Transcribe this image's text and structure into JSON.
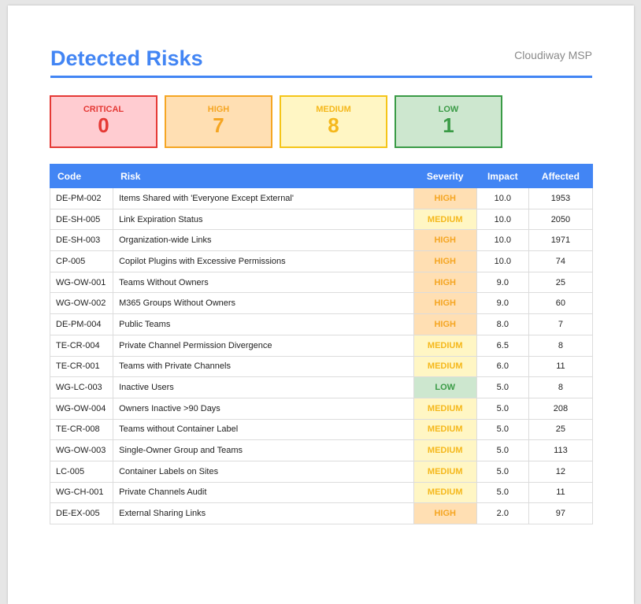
{
  "header": {
    "title": "Detected Risks",
    "brand": "Cloudiway MSP"
  },
  "summary": [
    {
      "label": "CRITICAL",
      "count": "0",
      "color": "#e53935"
    },
    {
      "label": "HIGH",
      "count": "7",
      "color": "#f5a623"
    },
    {
      "label": "MEDIUM",
      "count": "8",
      "color": "#f5b81c"
    },
    {
      "label": "LOW",
      "count": "1",
      "color": "#3a9b46"
    }
  ],
  "table": {
    "columns": [
      "Code",
      "Risk",
      "Severity",
      "Impact",
      "Affected"
    ],
    "rows": [
      {
        "code": "DE-PM-002",
        "risk": "Items Shared with 'Everyone Except External'",
        "severity": "HIGH",
        "impact": "10.0",
        "affected": "1953"
      },
      {
        "code": "DE-SH-005",
        "risk": "Link Expiration Status",
        "severity": "MEDIUM",
        "impact": "10.0",
        "affected": "2050"
      },
      {
        "code": "DE-SH-003",
        "risk": "Organization-wide Links",
        "severity": "HIGH",
        "impact": "10.0",
        "affected": "1971"
      },
      {
        "code": "CP-005",
        "risk": "Copilot Plugins with Excessive Permissions",
        "severity": "HIGH",
        "impact": "10.0",
        "affected": "74"
      },
      {
        "code": "WG-OW-001",
        "risk": "Teams Without Owners",
        "severity": "HIGH",
        "impact": "9.0",
        "affected": "25"
      },
      {
        "code": "WG-OW-002",
        "risk": "M365 Groups Without Owners",
        "severity": "HIGH",
        "impact": "9.0",
        "affected": "60"
      },
      {
        "code": "DE-PM-004",
        "risk": "Public Teams",
        "severity": "HIGH",
        "impact": "8.0",
        "affected": "7"
      },
      {
        "code": "TE-CR-004",
        "risk": "Private Channel Permission Divergence",
        "severity": "MEDIUM",
        "impact": "6.5",
        "affected": "8"
      },
      {
        "code": "TE-CR-001",
        "risk": "Teams with Private Channels",
        "severity": "MEDIUM",
        "impact": "6.0",
        "affected": "11"
      },
      {
        "code": "WG-LC-003",
        "risk": "Inactive Users",
        "severity": "LOW",
        "impact": "5.0",
        "affected": "8"
      },
      {
        "code": "WG-OW-004",
        "risk": "Owners Inactive >90 Days",
        "severity": "MEDIUM",
        "impact": "5.0",
        "affected": "208"
      },
      {
        "code": "TE-CR-008",
        "risk": "Teams without Container Label",
        "severity": "MEDIUM",
        "impact": "5.0",
        "affected": "25"
      },
      {
        "code": "WG-OW-003",
        "risk": "Single-Owner Group and Teams",
        "severity": "MEDIUM",
        "impact": "5.0",
        "affected": "113"
      },
      {
        "code": "LC-005",
        "risk": "Container Labels on Sites",
        "severity": "MEDIUM",
        "impact": "5.0",
        "affected": "12"
      },
      {
        "code": "WG-CH-001",
        "risk": "Private Channels Audit",
        "severity": "MEDIUM",
        "impact": "5.0",
        "affected": "11"
      },
      {
        "code": "DE-EX-005",
        "risk": "External Sharing Links",
        "severity": "HIGH",
        "impact": "2.0",
        "affected": "97"
      }
    ]
  },
  "colors": {
    "accent": "#4285f4",
    "high": "#f5a623",
    "medium": "#f5b81c",
    "low": "#3a9b46",
    "critical": "#e53935"
  }
}
